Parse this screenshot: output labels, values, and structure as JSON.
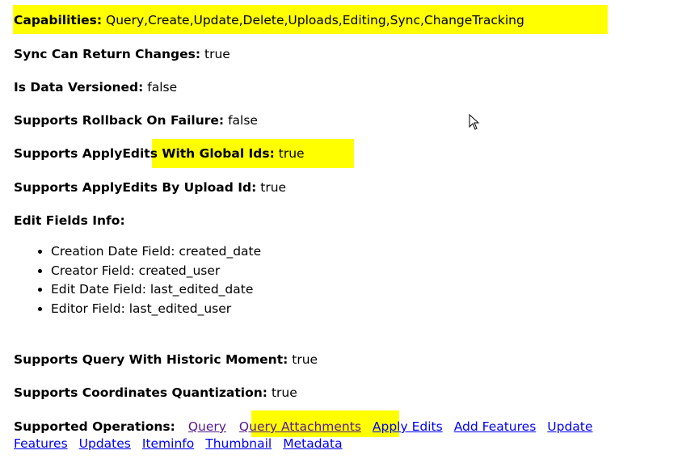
{
  "capabilities": {
    "label": "Capabilities:",
    "value": "Query,Create,Update,Delete,Uploads,Editing,Sync,ChangeTracking"
  },
  "props": [
    {
      "label": "Sync Can Return Changes:",
      "value": "true"
    },
    {
      "label": "Is Data Versioned:",
      "value": "false"
    },
    {
      "label": "Supports Rollback On Failure:",
      "value": "false"
    },
    {
      "label": "Supports ApplyEdits With Global Ids:",
      "value": "true"
    },
    {
      "label": "Supports ApplyEdits By Upload Id:",
      "value": "true"
    }
  ],
  "edit_fields": {
    "label": "Edit Fields Info:",
    "items": [
      "Creation Date Field: created_date",
      "Creator Field: created_user",
      "Edit Date Field: last_edited_date",
      "Editor Field: last_edited_user"
    ]
  },
  "props2": [
    {
      "label": "Supports Query With Historic Moment:",
      "value": "true"
    },
    {
      "label": "Supports Coordinates Quantization:",
      "value": "true"
    }
  ],
  "operations": {
    "label": "Supported Operations:",
    "links": [
      "Query",
      "Query Attachments",
      "Apply Edits",
      "Add Features",
      "Update Features",
      "Updates",
      "Iteminfo",
      "Thumbnail",
      "Metadata"
    ]
  },
  "highlight_color": "#ffff00"
}
